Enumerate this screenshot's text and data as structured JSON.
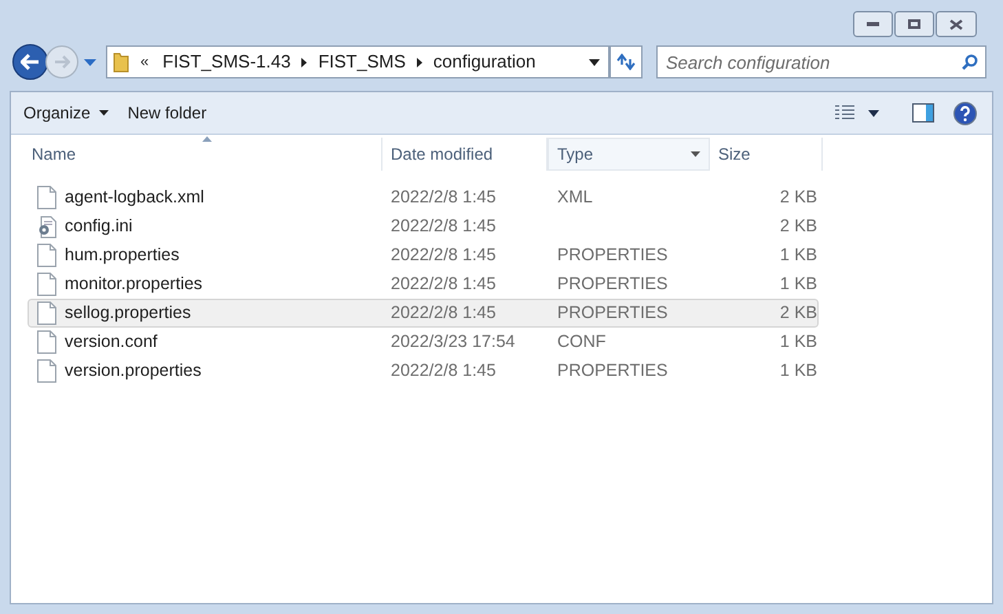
{
  "address": {
    "overflow": "«",
    "segments": [
      "FIST_SMS-1.43",
      "FIST_SMS",
      "configuration"
    ]
  },
  "search": {
    "placeholder": "Search configuration"
  },
  "toolbar": {
    "buttons": [
      {
        "label": "Organize",
        "dropdown": true
      },
      {
        "label": "New folder",
        "dropdown": false
      }
    ]
  },
  "table": {
    "columns": [
      {
        "label": "Name",
        "sorted": true,
        "dropdown": false
      },
      {
        "label": "Date modified",
        "sorted": false,
        "dropdown": false
      },
      {
        "label": "Type",
        "sorted": false,
        "dropdown": true
      },
      {
        "label": "Size",
        "sorted": false,
        "dropdown": false
      }
    ],
    "rows": [
      {
        "kind": "file",
        "name": "agent-logback.xml",
        "date": "2022/2/8 1:45",
        "type": "XML",
        "size": "2 KB",
        "selected": false
      },
      {
        "kind": "settings",
        "name": "config.ini",
        "date": "2022/2/8 1:45",
        "size": "2 KB",
        "selected": false
      },
      {
        "kind": "file",
        "name": "hum.properties",
        "date": "2022/2/8 1:45",
        "type": "PROPERTIES",
        "size": "1 KB",
        "selected": false
      },
      {
        "kind": "file",
        "name": "monitor.properties",
        "date": "2022/2/8 1:45",
        "type": "PROPERTIES",
        "size": "1 KB",
        "selected": false
      },
      {
        "kind": "file",
        "name": "sellog.properties",
        "date": "2022/2/8 1:45",
        "type": "PROPERTIES",
        "size": "2 KB",
        "selected": true
      },
      {
        "kind": "file",
        "name": "version.conf",
        "date": "2022/3/23 17:54",
        "type": "CONF",
        "size": "1 KB",
        "selected": false
      },
      {
        "kind": "file",
        "name": "version.properties",
        "date": "2022/2/8 1:45",
        "type": "PROPERTIES",
        "size": "1 KB",
        "selected": false
      }
    ]
  }
}
